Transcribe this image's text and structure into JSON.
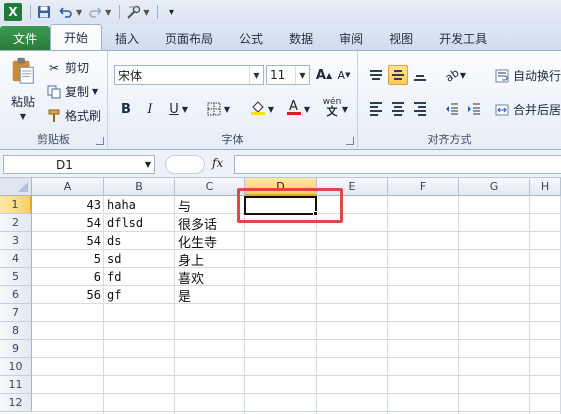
{
  "qat": {
    "logo": "X"
  },
  "tabs": [
    {
      "label": "文件",
      "kind": "file"
    },
    {
      "label": "开始",
      "kind": "active"
    },
    {
      "label": "插入"
    },
    {
      "label": "页面布局"
    },
    {
      "label": "公式"
    },
    {
      "label": "数据"
    },
    {
      "label": "审阅"
    },
    {
      "label": "视图"
    },
    {
      "label": "开发工具"
    }
  ],
  "clipboard": {
    "paste": "粘贴",
    "cut": "剪切",
    "copy": "复制",
    "format_painter": "格式刷",
    "label": "剪贴板"
  },
  "font": {
    "name": "宋体",
    "size": "11",
    "bold": "B",
    "italic": "I",
    "underline": "U",
    "wen": "wén",
    "label": "字体"
  },
  "alignment": {
    "wrap_text": "自动换行",
    "merge_center": "合并后居",
    "label": "对齐方式"
  },
  "formula_bar": {
    "name_box": "D1",
    "fx": "fx",
    "value": ""
  },
  "columns": [
    "A",
    "B",
    "C",
    "D",
    "E",
    "F",
    "G",
    "H"
  ],
  "selected_column": "D",
  "rows": [
    "1",
    "2",
    "3",
    "4",
    "5",
    "6",
    "7",
    "8",
    "9",
    "10",
    "11",
    "12"
  ],
  "selected_row": "1",
  "cells": [
    {
      "a": "43",
      "b": "haha",
      "c": "与"
    },
    {
      "a": "54",
      "b": "dflsd",
      "c": "很多话"
    },
    {
      "a": "54",
      "b": "ds",
      "c": "化生寺"
    },
    {
      "a": "5",
      "b": "sd",
      "c": "身上"
    },
    {
      "a": "6",
      "b": "fd",
      "c": "喜欢"
    },
    {
      "a": "56",
      "b": "gf",
      "c": "是"
    }
  ],
  "colors": {
    "accent": "#e0474c",
    "selection": "#f7cf68",
    "file_tab": "#2a7d3a"
  }
}
